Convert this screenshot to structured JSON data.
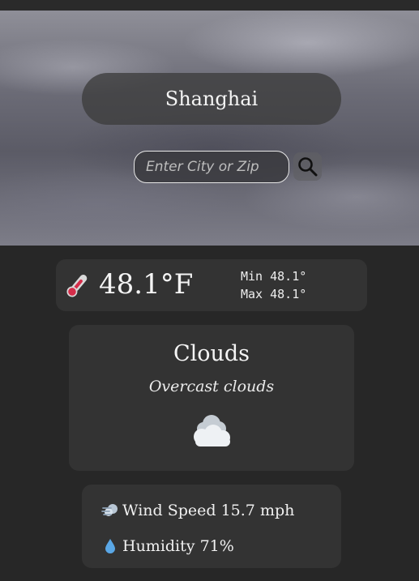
{
  "location": {
    "city": "Shanghai"
  },
  "search": {
    "placeholder": "Enter City or Zip",
    "value": ""
  },
  "current": {
    "temperature": "48.1°F",
    "min_label": "Min",
    "min_value": "48.1°",
    "max_label": "Max",
    "max_value": "48.1°"
  },
  "conditions": {
    "main": "Clouds",
    "description": "Overcast clouds",
    "icon": "cloud-icon"
  },
  "stats": {
    "wind_label": "Wind Speed",
    "wind_value": "15.7 mph",
    "humidity_label": "Humidity",
    "humidity_value": "71%"
  },
  "icons": {
    "thermometer": "thermometer-icon",
    "search": "search-icon",
    "wind": "wind-icon",
    "humidity": "droplet-icon"
  },
  "colors": {
    "background": "#272727",
    "card": "#333333",
    "city_pill": "#3c3c3c"
  }
}
